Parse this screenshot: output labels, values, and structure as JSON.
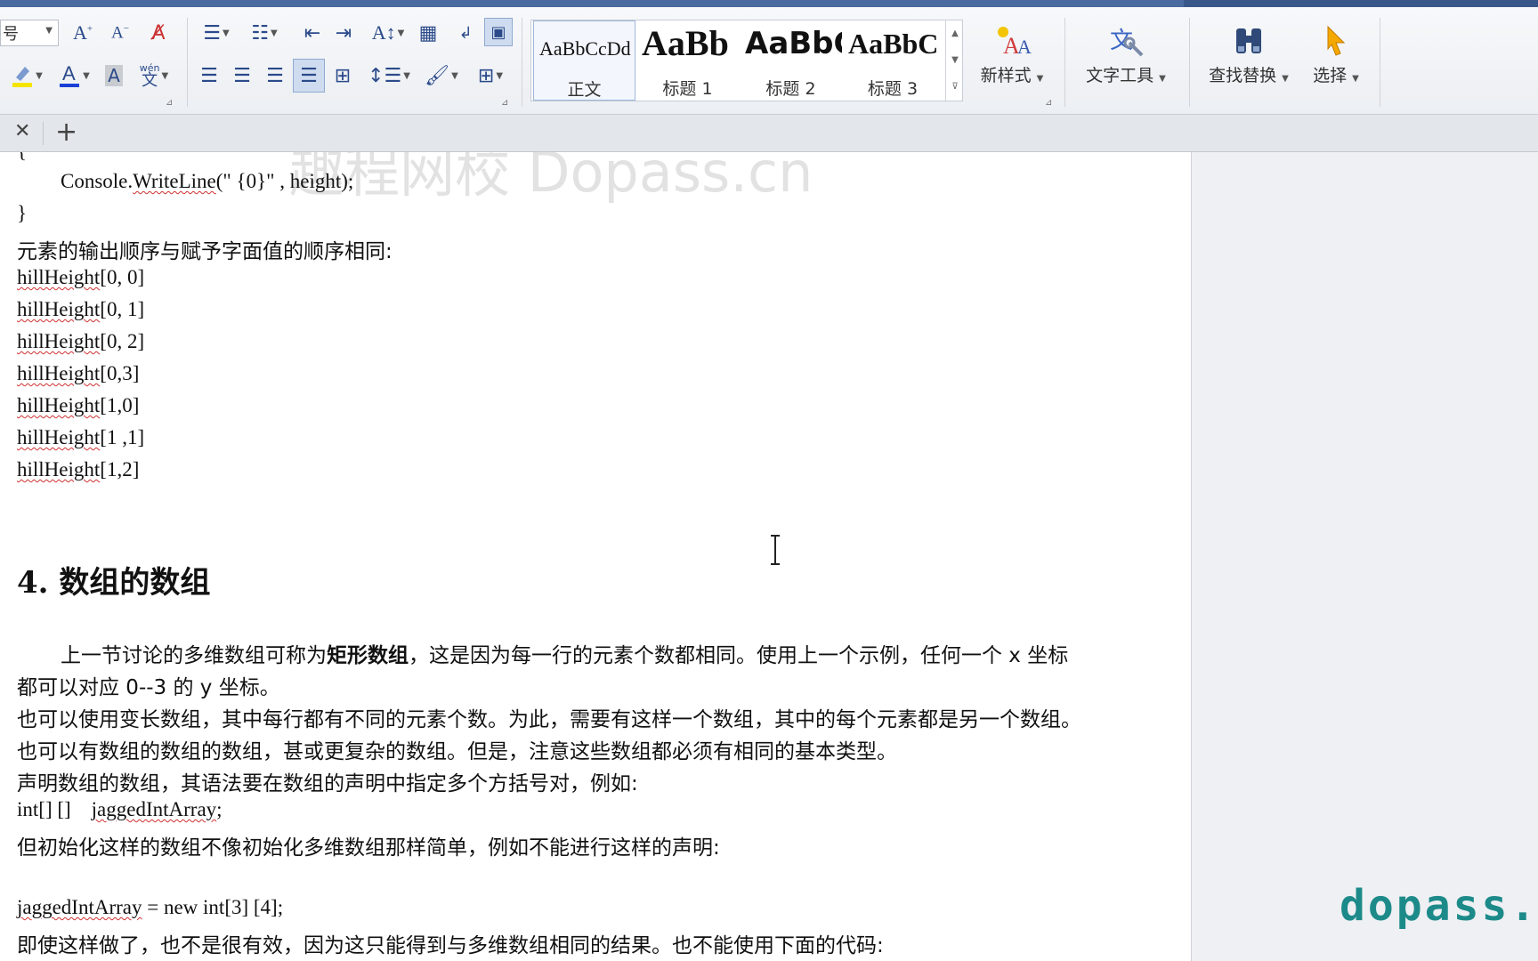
{
  "ribbon": {
    "font_size_value": "号",
    "styles": [
      {
        "preview": "AaBbCcDd",
        "name": "正文",
        "selected": true
      },
      {
        "preview": "AaBb",
        "name": "标题 1",
        "selected": false
      },
      {
        "preview": "AaBbC",
        "name": "标题 2",
        "selected": false
      },
      {
        "preview": "AaBbC",
        "name": "标题 3",
        "selected": false
      }
    ],
    "new_style": "新样式",
    "text_tools": "文字工具",
    "find_replace": "查找替换",
    "select": "选择",
    "phonetic_glyph": "wén"
  },
  "tabbar": {
    "close": "✕",
    "add": "+"
  },
  "document": {
    "code_brace_open": "{",
    "code_line": "Console.WriteLine(\" {0}\" , height);",
    "code_console": "Console.",
    "code_writeline": "WriteLine",
    "code_rest": "(\" {0}\" , height);",
    "code_brace_close": "}",
    "output_order_text": "元素的输出顺序与赋予字面值的顺序相同:",
    "hill_items": [
      {
        "name": "hillHeight",
        "idx": "[0, 0]"
      },
      {
        "name": "hillHeight",
        "idx": "[0, 1]"
      },
      {
        "name": "hillHeight",
        "idx": "[0, 2]"
      },
      {
        "name": "hillHeight",
        "idx": "[0,3]"
      },
      {
        "name": "hillHeight",
        "idx": "[1,0]"
      },
      {
        "name": "hillHeight",
        "idx": "[1 ,1]"
      },
      {
        "name": "hillHeight",
        "idx": "[1,2]"
      }
    ],
    "heading": "4.  数组的数组",
    "para1_a": "上一节讨论的多维数组可称为",
    "para1_bold": "矩形数组",
    "para1_b": "，这是因为每一行的元素个数都相同。使用上一个示例，任何一个 x 坐标",
    "para1_c": "都可以对应 0--3  的 y  坐标。",
    "para2": "也可以使用变长数组，其中每行都有不同的元素个数。为此，需要有这样一个数组，其中的每个元素都是另一个数组。",
    "para3": "也可以有数组的数组的数组，甚或更复杂的数组。但是，注意这些数组都必须有相同的基本类型。",
    "para4": "声明数组的数组，其语法要在数组的声明中指定多个方括号对，例如:",
    "decl_type": "int[] []    ",
    "decl_name": "jaggedIntArray",
    "decl_end": ";",
    "para5": "但初始化这样的数组不像初始化多维数组那样简单，例如不能进行这样的声明:",
    "init_name": "jaggedIntArray",
    "init_rest": " = new int[3] [4];",
    "para6": "即使这样做了，也不是很有效，因为这只能得到与多维数组相同的结果。也不能使用下面的代码:"
  },
  "watermarks": {
    "top": "趣程网校 Dopass.cn",
    "bottom_right": "dopass. c"
  }
}
